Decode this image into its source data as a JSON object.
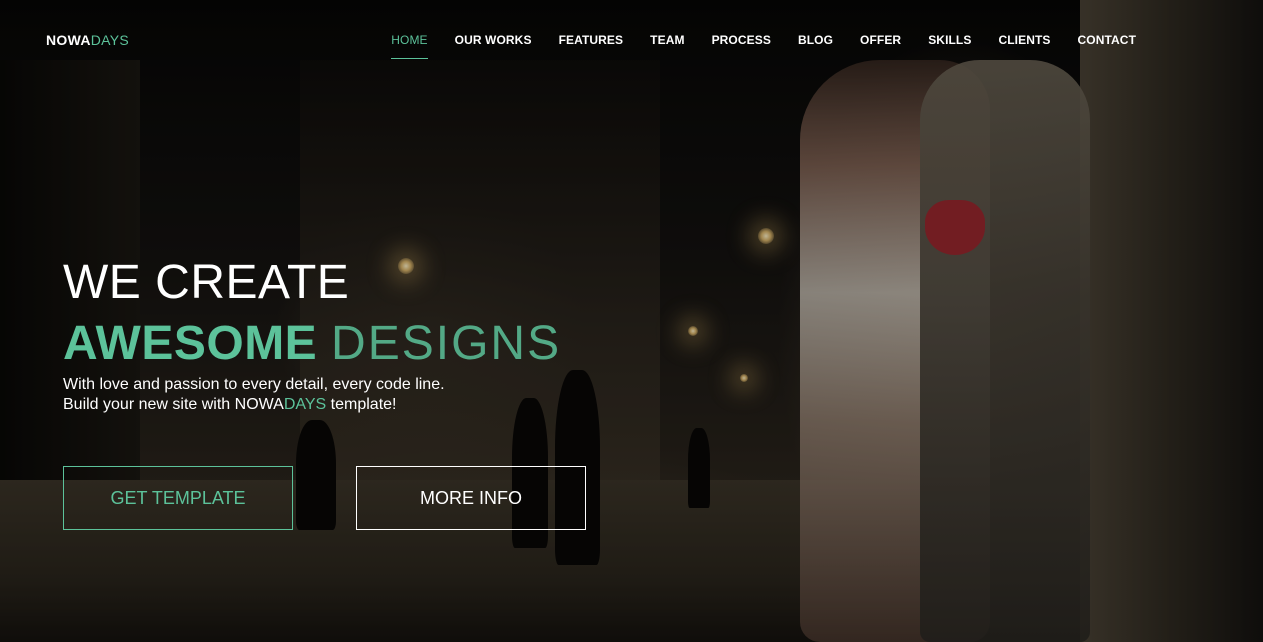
{
  "brand": {
    "logo_main": "NOWA",
    "logo_accent": "DAYS"
  },
  "nav": {
    "items": [
      {
        "label": "HOME",
        "active": true
      },
      {
        "label": "OUR WORKS"
      },
      {
        "label": "FEATURES"
      },
      {
        "label": "TEAM"
      },
      {
        "label": "PROCESS"
      },
      {
        "label": "BLOG"
      },
      {
        "label": "OFFER"
      },
      {
        "label": "SKILLS"
      },
      {
        "label": "CLIENTS"
      },
      {
        "label": "CONTACT"
      }
    ]
  },
  "hero": {
    "line1": "WE CREATE",
    "line2_strong": "AWESOME",
    "line2_light": "DESIGNS",
    "lede_line1": "With love and passion to every detail, every code line.",
    "lede_line2_prefix": "Build your new site with ",
    "lede_line2_brand_main": "NOWA",
    "lede_line2_brand_accent": "DAYS",
    "lede_line2_suffix": " template!"
  },
  "buttons": {
    "get_template": "GET TEMPLATE",
    "more_info": "MORE INFO"
  },
  "colors": {
    "accent": "#5cc29a",
    "text": "#ffffff",
    "background": "#0b0a08"
  }
}
